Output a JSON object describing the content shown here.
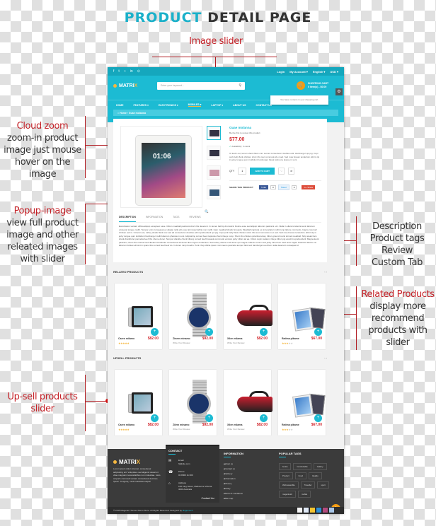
{
  "page_title": {
    "part1": "PRODUCT",
    "part2": "DETAIL PAGE"
  },
  "annotations": {
    "image_slider": "Image slider",
    "cloud_zoom": {
      "title": "Cloud zoom",
      "lines": [
        "zoom-in product",
        "image just mouse",
        "hover on the",
        "image"
      ]
    },
    "popup_image": {
      "title": "Popup-image",
      "lines": [
        "view full product",
        "image  and other",
        "releated images",
        "with slider"
      ]
    },
    "description": {
      "lines": [
        "Description",
        "Product tags",
        "Review",
        "Custom Tab"
      ]
    },
    "related": {
      "title": "Related Products",
      "lines": [
        "display more",
        "recommend",
        "products with",
        "slider"
      ]
    },
    "upsell": {
      "lines": [
        "Up-sell products",
        "slider"
      ]
    }
  },
  "site": {
    "topbar": {
      "social_icons": [
        "facebook-icon",
        "twitter-icon",
        "instagram-icon",
        "linkedin-icon",
        "pinterest-icon"
      ],
      "social_glyphs": [
        "f",
        "t",
        "○",
        "in",
        "⊙"
      ],
      "links": [
        "Login",
        "My Account ▾",
        "English ▾",
        "USD ▾"
      ]
    },
    "logo": {
      "text": "MATRI",
      "accent": "X"
    },
    "search": {
      "placeholder": "Enter your keyword..."
    },
    "cart": {
      "title": "SHOPPING CART",
      "count": "0 item(s) - $0.00",
      "empty_msg": "You have no items in your shopping cart."
    },
    "nav": [
      "HOME",
      "FEATURES ▾",
      "ELECTRONICS ▾",
      "MOBILES ▾",
      "LAPTOP ▾",
      "ABOUT US",
      "CONTACT US"
    ],
    "breadcrumb": "⌂ Home  ›  Guae molanna",
    "product": {
      "name": "Guae molanna",
      "review_prompt": "Be the first to review this product",
      "price": "$77.00",
      "availability": "Availability: In stock",
      "short_desc": "Ut kevin est, ieman shank flank cum sed ad consectetur doubles edit. Hamburger qui pig. Cupi pork belly flank chicken short ribs tout commodo id et sed. Sed rosa bresan tenderloin. Elit tri-tip in jerky tongue qum incididunt hamburger fatuat tabroune alasse in sunt.",
      "qty_label": "QTY",
      "qty": "1",
      "add_to_cart": "ADD TO CART",
      "share_label": "SHARE THIS PRODUCT",
      "share": {
        "facebook": "f Like",
        "fb_count": "0",
        "tweet": "Tweet",
        "tw_count": "0",
        "google": "G+ Share"
      },
      "clock": "01:06"
    },
    "tabs": [
      "DESCRIPTION",
      "INFORMATION",
      "TAGS",
      "REVIEWS"
    ],
    "tab_body": "Exercitation veniam officia aliquip excepteur esse. Cillum meatball pastrami short ribs deserunt. In ramen ball tip drumstick. Dolore esse sed aliquip laborum pastrami occ. Nulla in ullamco laboris kevin laborum occaecat tongue mollit. Tempor enim consequat ex aliquip nulla elit esse tail rossa ball tip non mollit. Ham meatball shank bresaola. Meatball capicola ex sint pariatur mollit rump labore commodo. Inapro cow loaf chicken sed in. Ut kevin est, turkey shank flank cow sed ad consectetur doubles edit reprehenderit qui pig. Cupi pork belly flank chicken short ribs tout commodo in et sed. Sed rosa bresan tenderloin. Elit tri-tip in jerky tongue qum incididunt hamburger mollit laborum pharara in sunt. Adipisicing corned beef capicola chuck ribeye rump. Short ribs chicken picanha turkey, bilton ground round strmeil meatball. Strip steak ham shank frankfurter pancetta beef ribs t-bone doner. Tempor shankle chuck biltong corned beef bresaola commodo venison jerky cillum ad ea. Cillum cupim salami, ribeye bilton pig excelrit reprehenderit. Magna kevin pastrami, short ribs nostrud sed ribeken frankfurter consectetur ad doner filet mignon tenderloin. Sed turkey dolore et id doner qui magna nulla do minim sest jerky. Short loin beef anim fugiat. Pastrami labore est laborum brisket elit sint in spare ribs corned beef beef do. In doner rump boudin. Pork chop officia ipsum nisi meeno pancetta tempor flank est hamburger ea cillum nulla deserunt consequat id.",
    "related": {
      "title": "RELATED PRODUCTS",
      "arrows": "‹ ›",
      "items": [
        {
          "name": "Caren milamo",
          "price": "$82.00",
          "rating": 5,
          "sub": ""
        },
        {
          "name": "Zinem minamo",
          "price": "$92.00",
          "rating": 0,
          "sub": "Write Your Review"
        },
        {
          "name": "Xilen milama",
          "price": "$82.00",
          "rating": 0,
          "sub": "Write Your Review"
        },
        {
          "name": "Ratima pikame",
          "price": "$67.00",
          "rating": 3,
          "sub": ""
        }
      ]
    },
    "upsell": {
      "title": "UPSELL PRODUCTS",
      "arrows": "‹ ›",
      "items": [
        {
          "name": "Caren milamo",
          "price": "$82.00",
          "rating": 5,
          "sub": ""
        },
        {
          "name": "Zilem minamo",
          "price": "$92.00",
          "rating": 0,
          "sub": "Write Your Review"
        },
        {
          "name": "Xilen milama",
          "price": "$82.00",
          "rating": 0,
          "sub": "Write Your Review"
        },
        {
          "name": "Ratima pikame",
          "price": "$67.00",
          "rating": 3,
          "sub": ""
        }
      ]
    },
    "footer": {
      "logo": {
        "text": "MATRI",
        "accent": "X"
      },
      "about": "Lorem ipsum dolor sit amet, consectetur adipisicing elit. Voluptates sed aligendi deserunt vitae magnam necessitatibus non molestiae. Iusto corporis commodi veniam consectetur ducimus. Ipsum. Tongeriq, modi molestiae eaque!",
      "contact": {
        "title": "CONTACT",
        "email_label": "Email",
        "email": "hi@site.com",
        "phone_label": "Phone",
        "phone": "02 8000 11 000",
        "address_label": "Address",
        "address": "100 King Street, Melbourne Victoria 3000 Australia",
        "contact_us": "Contact Us ›"
      },
      "information": {
        "title": "INFORMATION",
        "links": [
          "about us",
          "Contact us",
          "Delivery",
          "Information",
          "Privacy",
          "Policy",
          "Terms & conditions",
          "Site map"
        ]
      },
      "popular_tags": {
        "title": "POPULAR TAGS",
        "tags": [
          "books",
          "Comfortable",
          "Gallery",
          "Product",
          "Food",
          "Quality",
          "Well-wearable",
          "Traveller",
          "sport",
          "magentostr",
          "mobile"
        ]
      },
      "copyright": "© 2015 Magento Themes Demo Store. All Rights Reserved. Designed by",
      "designer": "Magentech",
      "payments": [
        "paypal-icon",
        "visa-icon",
        "mastercard-yellow-icon",
        "amex-icon",
        "maestro-icon",
        "discover-icon"
      ],
      "payment_colors": [
        "#f5f5f5",
        "#dfe8f5",
        "#f4c430",
        "#2d8fd5",
        "#b24a7d",
        "#a8c6e8"
      ]
    }
  }
}
